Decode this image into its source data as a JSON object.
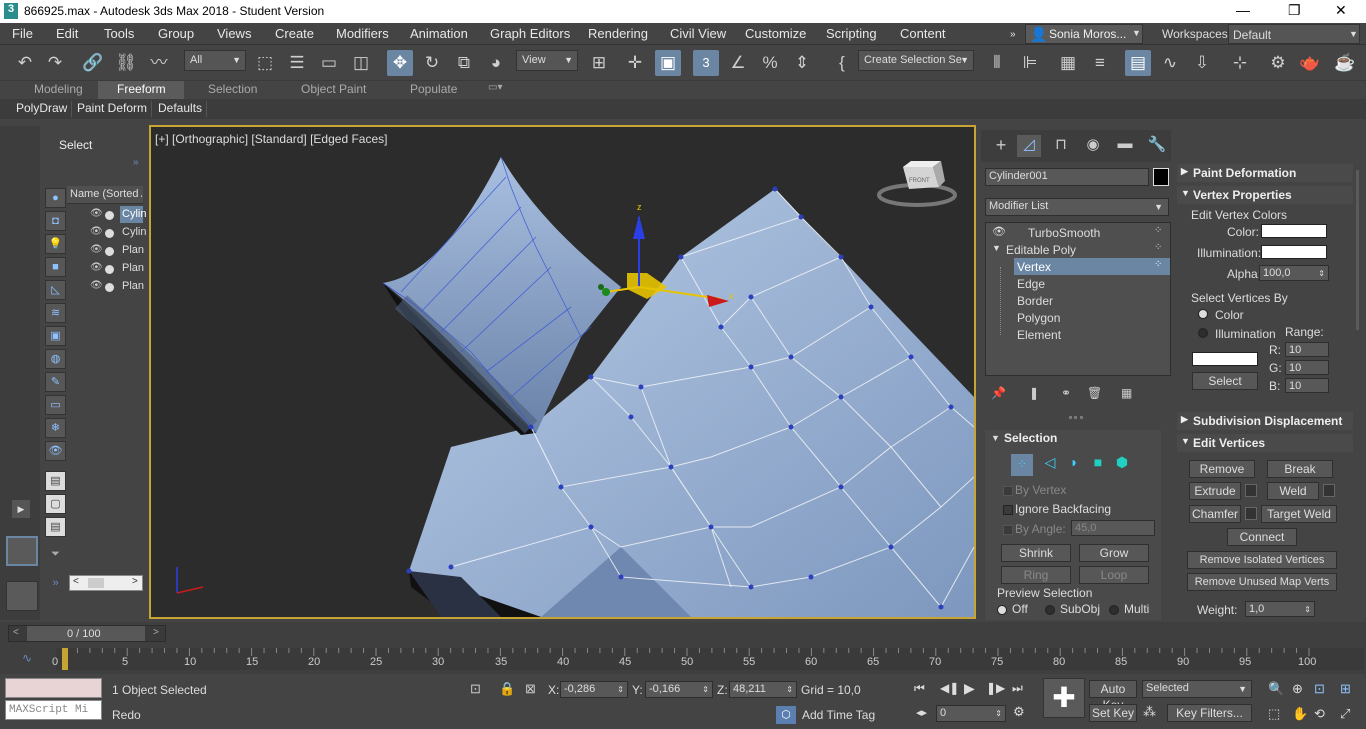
{
  "window": {
    "title": "866925.max - Autodesk 3ds Max 2018 - Student Version",
    "controls": [
      "—",
      "❐",
      "✕"
    ]
  },
  "menu": [
    "File",
    "Edit",
    "Tools",
    "Group",
    "Views",
    "Create",
    "Modifiers",
    "Animation",
    "Graph Editors",
    "Rendering",
    "Civil View",
    "Customize",
    "Scripting",
    "Content"
  ],
  "user": {
    "name": "Sonia Moros...",
    "workspaces_label": "Workspaces:",
    "workspace": "Default"
  },
  "toolbar": {
    "filter": "All",
    "ref_coord": "View",
    "selection_set": "Create Selection Se"
  },
  "ribbon": {
    "tabs": [
      "Modeling",
      "Freeform",
      "Selection",
      "Object Paint",
      "Populate"
    ],
    "active_tab": "Freeform",
    "subtabs": [
      "PolyDraw",
      "Paint Deform",
      "Defaults"
    ]
  },
  "scene_explorer": {
    "title": "Select",
    "column": "Name (Sorted A",
    "items": [
      "Cylin",
      "Cylin",
      "Plan",
      "Plan",
      "Plan"
    ]
  },
  "viewport": {
    "label": "[+] [Orthographic] [Standard] [Edged Faces]",
    "viewcube": "FRONT",
    "gizmo": {
      "x": "x",
      "z": "z"
    }
  },
  "command_panel": {
    "object_name": "Cylinder001",
    "modifier_list": "Modifier List",
    "stack": [
      "TurboSmooth",
      "Editable Poly",
      "Vertex",
      "Edge",
      "Border",
      "Polygon",
      "Element"
    ],
    "selected": "Vertex",
    "selection_rollout": {
      "title": "Selection",
      "by_vertex": "By Vertex",
      "ignore_backfacing": "Ignore Backfacing",
      "by_angle": "By Angle:",
      "angle": "45,0",
      "shrink": "Shrink",
      "grow": "Grow",
      "ring": "Ring",
      "loop": "Loop",
      "preview": "Preview Selection",
      "preview_opts": [
        "Off",
        "SubObj",
        "Multi"
      ]
    }
  },
  "right_panel": {
    "paint_deformation": "Paint Deformation",
    "vertex_properties": "Vertex Properties",
    "edit_vertex_colors": "Edit Vertex Colors",
    "color": "Color:",
    "illumination": "Illumination:",
    "alpha": "Alpha:",
    "alpha_val": "100,0",
    "select_vertices_by": "Select Vertices By",
    "opt_color": "Color",
    "opt_illum": "Illumination",
    "range": "Range:",
    "r": "R:",
    "g": "G:",
    "b": "B:",
    "rgb": [
      "10",
      "10",
      "10"
    ],
    "select": "Select",
    "subdiv_disp": "Subdivision Displacement",
    "edit_vertices": "Edit Vertices",
    "remove": "Remove",
    "break": "Break",
    "extrude": "Extrude",
    "weld": "Weld",
    "chamfer": "Chamfer",
    "target_weld": "Target Weld",
    "connect": "Connect",
    "remove_isolated": "Remove Isolated Vertices",
    "remove_unused": "Remove Unused Map Verts",
    "weight": "Weight:",
    "weight_val": "1,0"
  },
  "timeline": {
    "frame": "0 / 100",
    "ticks": [
      "0",
      "5",
      "10",
      "15",
      "20",
      "25",
      "30",
      "35",
      "40",
      "45",
      "50",
      "55",
      "60",
      "65",
      "70",
      "75",
      "80",
      "85",
      "90",
      "95",
      "100"
    ]
  },
  "status": {
    "maxscript": "MAXScript Mi",
    "selected_text": "1 Object Selected",
    "redo": "Redo",
    "x_label": "X:",
    "x": "-0,286",
    "y_label": "Y:",
    "y": "-0,166",
    "z_label": "Z:",
    "z": "48,211",
    "grid": "Grid = 10,0",
    "add_time_tag": "Add Time Tag",
    "auto_key": "Auto Key",
    "set_key": "Set Key",
    "key_mode": "Selected",
    "key_filters": "Key Filters...",
    "frame": "0"
  }
}
